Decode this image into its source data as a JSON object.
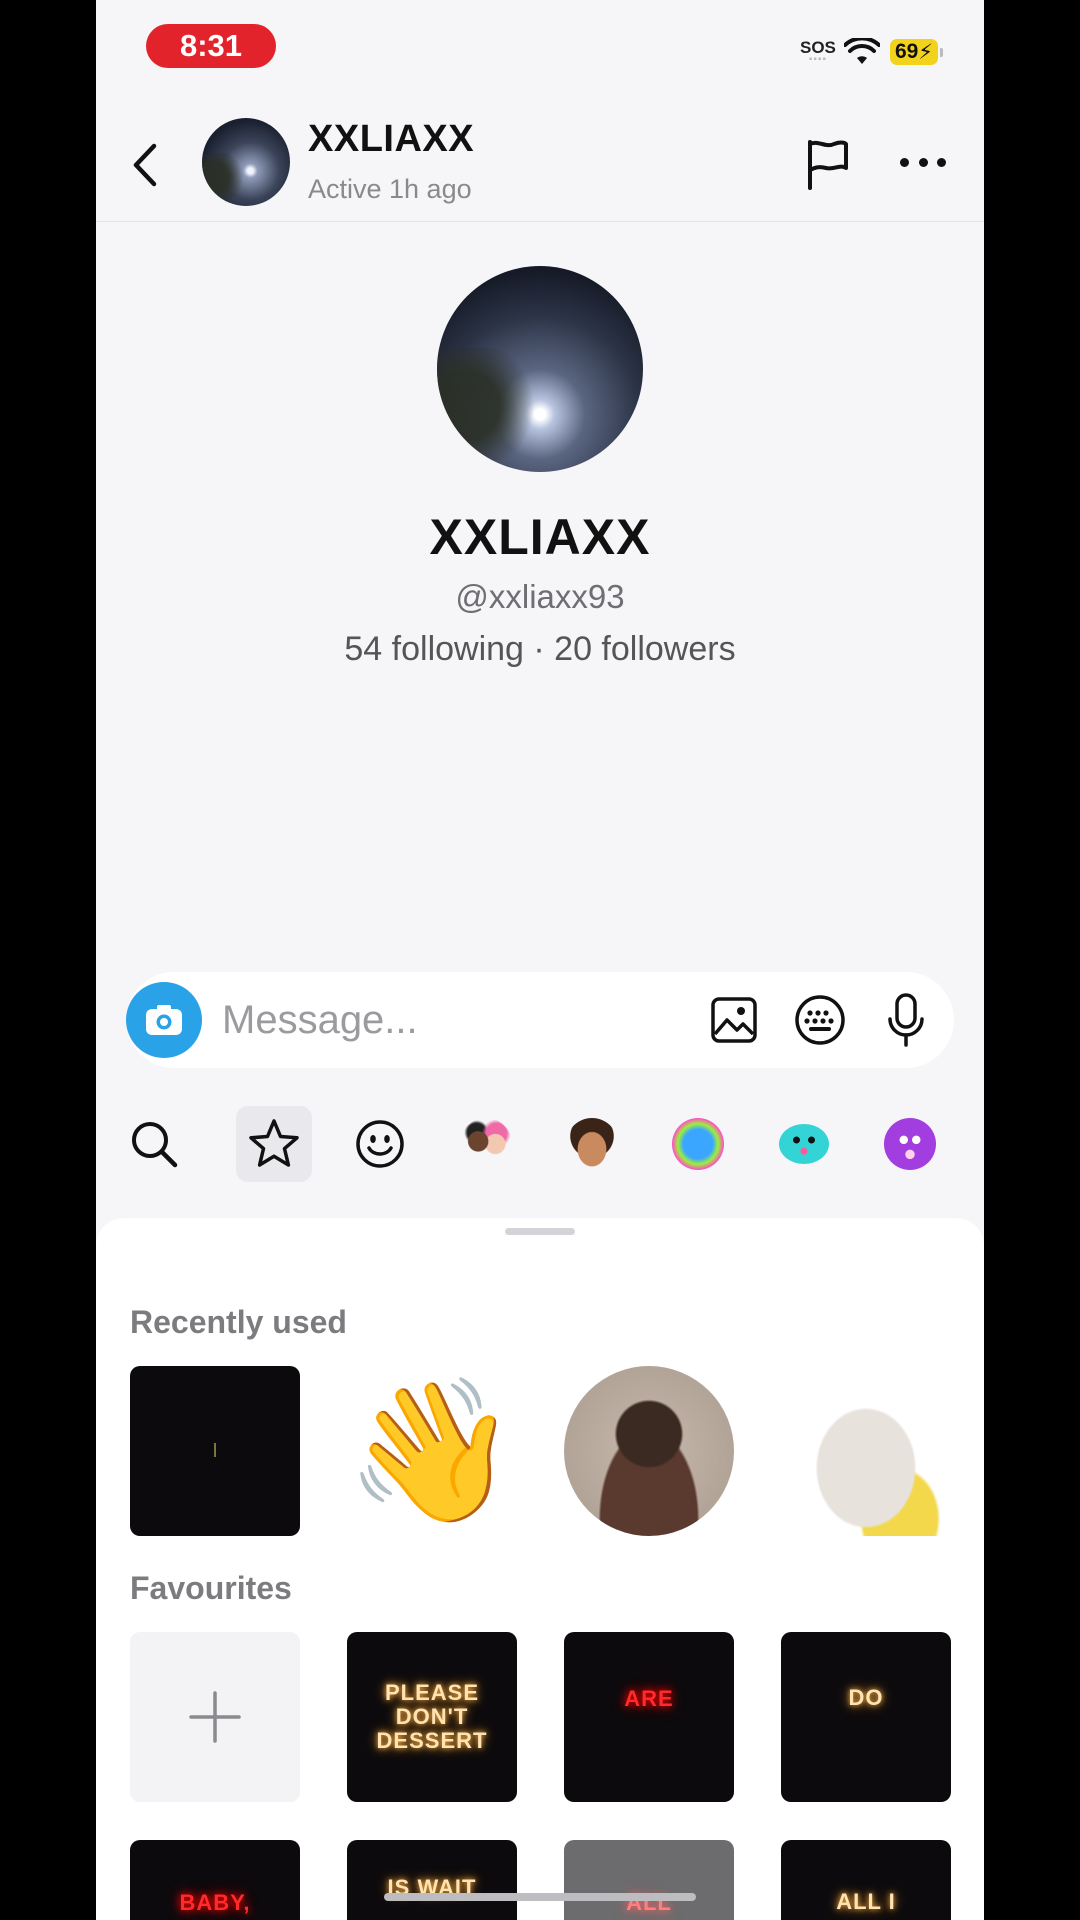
{
  "status_bar": {
    "time": "8:31",
    "sos": "SOS",
    "battery": "69"
  },
  "header": {
    "name": "XXLIAXX",
    "status": "Active 1h ago"
  },
  "profile": {
    "name": "XXLIAXX",
    "handle": "@xxliaxx93",
    "stats": "54 following · 20 followers"
  },
  "composer": {
    "placeholder": "Message..."
  },
  "tabs": [
    "search",
    "favorites",
    "emoji",
    "bitmoji-friends",
    "bitmoji-me",
    "sticker-pack-1",
    "sticker-pack-2",
    "sticker-pack-3"
  ],
  "sections": {
    "recent_title": "Recently used",
    "favourites_title": "Favourites"
  },
  "recent": [
    {
      "text": "I",
      "kind": "dark-text"
    },
    {
      "text": "👋",
      "kind": "emoji"
    },
    {
      "text": "",
      "kind": "photo"
    },
    {
      "text": "",
      "kind": "hand"
    }
  ],
  "favourites": [
    {
      "text": "+",
      "kind": "add"
    },
    {
      "text": "PLEASE DON'T DESSERT",
      "kind": "neon-warm"
    },
    {
      "text": "ARE",
      "kind": "neon-red"
    },
    {
      "text": "DO",
      "kind": "neon-warm"
    },
    {
      "text": "BABY,",
      "kind": "neon-red"
    },
    {
      "text": "IS WAIT",
      "kind": "neon-warm"
    },
    {
      "text": "ALL",
      "kind": "neon-red"
    },
    {
      "text": "ALL I",
      "kind": "neon-warm"
    }
  ],
  "colors": {
    "accent_camera": "#2aa2e8",
    "time_pill": "#e2232b",
    "battery": "#f3d21c"
  }
}
